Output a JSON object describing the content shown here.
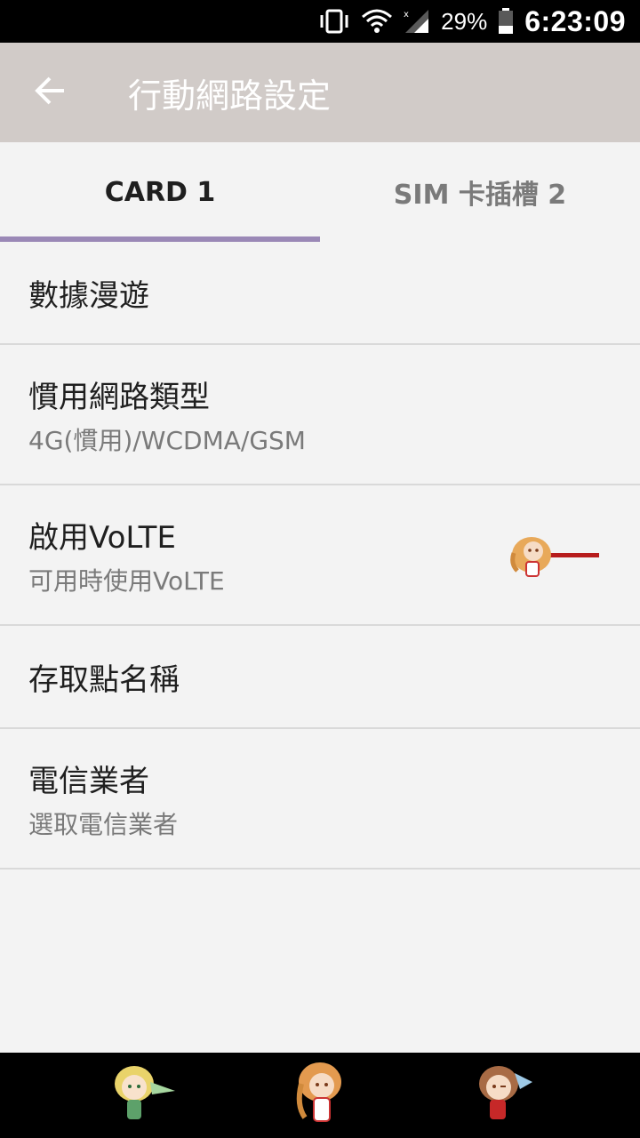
{
  "status_bar": {
    "battery_percent": "29%",
    "time": "6:23:09",
    "icons": [
      "vibrate-icon",
      "wifi-icon",
      "cell-signal-icon",
      "battery-icon"
    ]
  },
  "app_bar": {
    "title": "行動網路設定",
    "back_icon": "arrow-left-icon"
  },
  "tabs": [
    {
      "label": "CARD 1",
      "active": true
    },
    {
      "label": "SIM 卡插槽 2",
      "active": false
    }
  ],
  "settings": [
    {
      "title": "數據漫遊"
    },
    {
      "title": "慣用網路類型",
      "subtitle": "4G(慣用)/WCDMA/GSM"
    },
    {
      "title": "啟用VoLTE",
      "subtitle": "可用時使用VoLTE",
      "toggle_on": false,
      "toggle_icon": "character-toggle-icon"
    },
    {
      "title": "存取點名稱"
    },
    {
      "title": "電信業者",
      "subtitle": "選取電信業者"
    }
  ],
  "nav_bar": {
    "buttons": [
      "back-character-icon",
      "home-character-icon",
      "recents-character-icon"
    ]
  },
  "colors": {
    "app_bar_bg": "#d1cbc8",
    "tab_indicator": "#9a88b6",
    "background": "#f3f3f3",
    "toggle_track": "#b71c1c"
  }
}
